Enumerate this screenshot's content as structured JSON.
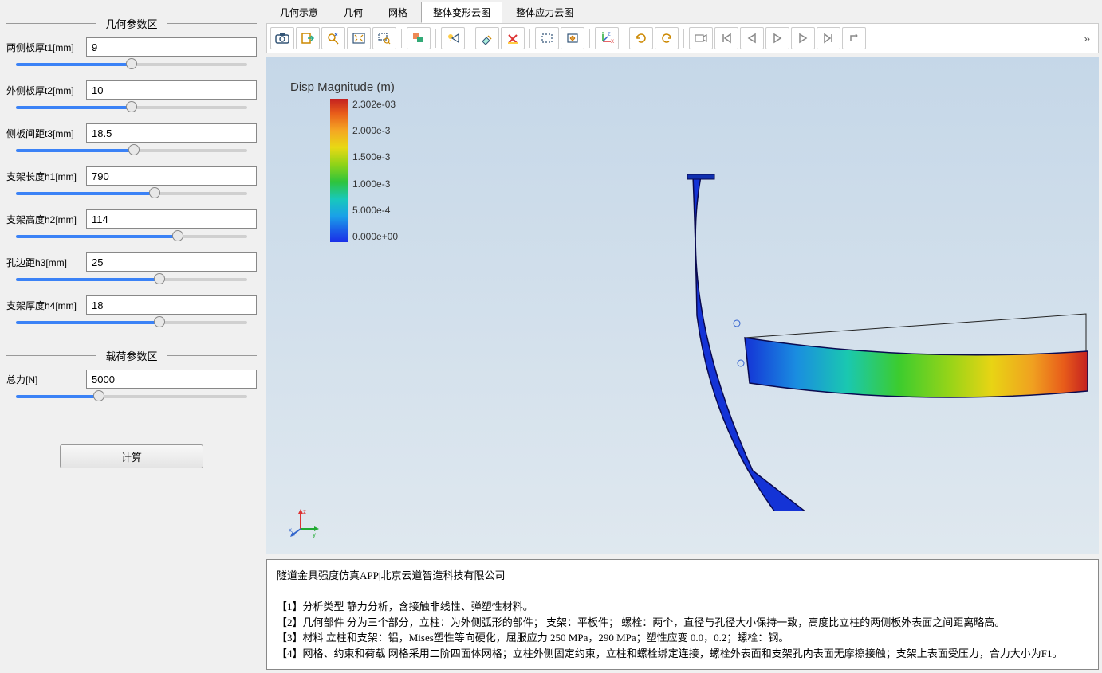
{
  "sections": {
    "geometry_title": "几何参数区",
    "load_title": "载荷参数区"
  },
  "params": {
    "t1": {
      "label": "两侧板厚t1[mm]",
      "value": "9",
      "pct": 50
    },
    "t2": {
      "label": "外侧板厚t2[mm]",
      "value": "10",
      "pct": 50
    },
    "t3": {
      "label": "侧板间距t3[mm]",
      "value": "18.5",
      "pct": 51
    },
    "h1": {
      "label": "支架长度h1[mm]",
      "value": "790",
      "pct": 60
    },
    "h2": {
      "label": "支架高度h2[mm]",
      "value": "114",
      "pct": 70
    },
    "h3": {
      "label": "孔边距h3[mm]",
      "value": "25",
      "pct": 62
    },
    "h4": {
      "label": "支架厚度h4[mm]",
      "value": "18",
      "pct": 62
    },
    "F": {
      "label": "总力[N]",
      "value": "5000",
      "pct": 36
    }
  },
  "compute_button": "计算",
  "tabs": {
    "t0": "几何示意",
    "t1": "几何",
    "t2": "网格",
    "t3": "整体变形云图",
    "t4": "整体应力云图"
  },
  "legend": {
    "title": "Disp Magnitude (m)",
    "v0": "2.302e-03",
    "v1": "2.000e-3",
    "v2": "1.500e-3",
    "v3": "1.000e-3",
    "v4": "5.000e-4",
    "v5": "0.000e+00"
  },
  "info": {
    "header": "隧道金具强度仿真APP|北京云道智造科技有限公司",
    "l1": "【1】分析类型 静力分析，含接触非线性、弹塑性材料。",
    "l2": "【2】几何部件 分为三个部分，立柱：为外侧弧形的部件； 支架：平板件； 螺栓：两个，直径与孔径大小保持一致，高度比立柱的两侧板外表面之间距离略高。",
    "l3": "【3】材料 立柱和支架：铝，Mises塑性等向硬化，屈服应力 250 MPa，290 MPa；塑性应变 0.0，0.2；螺栓：钢。",
    "l4": "【4】网格、约束和荷载 网格采用二阶四面体网格；立柱外侧固定约束，立柱和螺栓绑定连接，螺栓外表面和支架孔内表面无摩擦接触；支架上表面受压力，合力大小为F1。"
  },
  "overflow": "»"
}
